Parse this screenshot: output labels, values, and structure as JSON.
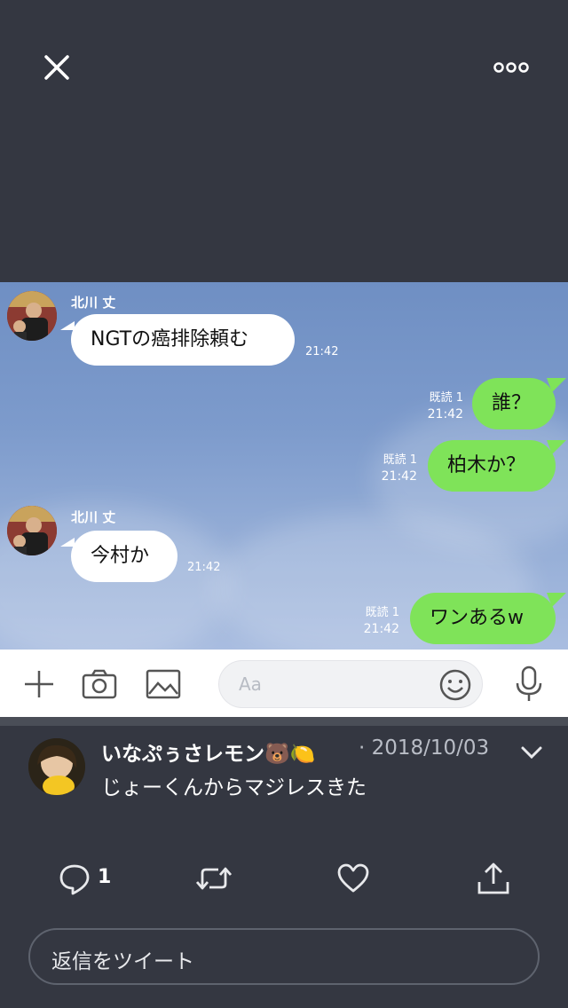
{
  "viewer": {
    "close_icon": "close-icon",
    "more_icon": "more-dots-icon"
  },
  "chat": {
    "messages": [
      {
        "side": "in",
        "sender": "北川 丈",
        "text": "NGTの癌排除頼む",
        "time": "21:42"
      },
      {
        "side": "out",
        "read": "既読 1",
        "text": "誰？",
        "time": "21:42"
      },
      {
        "side": "out",
        "read": "既読 1",
        "text": "柏木か？",
        "time": "21:42"
      },
      {
        "side": "in",
        "sender": "北川 丈",
        "text": "今村か",
        "time": "21:42"
      },
      {
        "side": "out",
        "read": "既読 1",
        "text": "ワンあるw",
        "time": "21:42"
      }
    ],
    "input_placeholder": "Aa"
  },
  "tweet": {
    "author": "いなぷぅさレモン🐻🍋",
    "date": "· 2018/10/03",
    "text": "じょーくんからマジレスきた",
    "reply_count": "1",
    "reply_placeholder": "返信をツイート"
  },
  "colors": {
    "dark_bg": "#343741",
    "bubble_out": "#7fe359",
    "bubble_in": "#ffffff"
  }
}
